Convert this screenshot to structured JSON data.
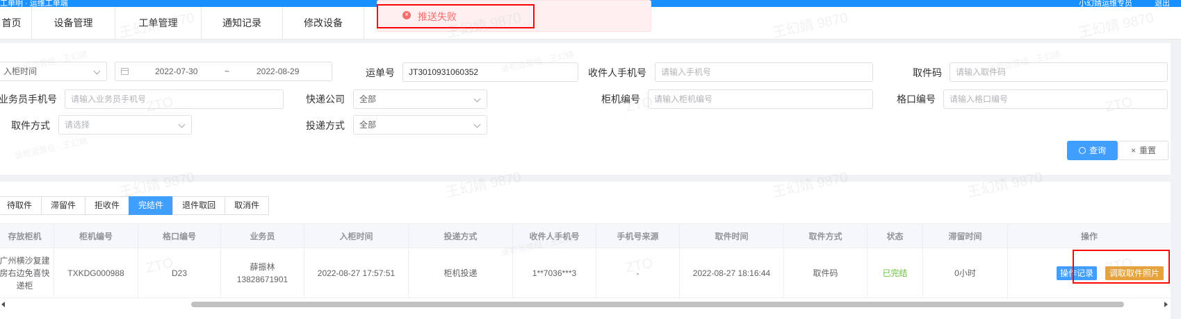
{
  "colors": {
    "primary": "#409eff",
    "success": "#67c23a",
    "warning": "#e6a23c",
    "danger": "#f56c6c",
    "topbar": "#1890ff"
  },
  "topbar": {
    "left_text": "工单明 · 运维工单端",
    "right_text": "小幻婧运维专员",
    "logout": "退出"
  },
  "nav": {
    "items": [
      {
        "label": "首页"
      },
      {
        "label": "设备管理"
      },
      {
        "label": "工单管理"
      },
      {
        "label": "通知记录"
      },
      {
        "label": "修改设备"
      }
    ]
  },
  "toast": {
    "icon": "error-circle-icon",
    "message": "推送失败"
  },
  "filters": {
    "time_type": "入柜时间",
    "date_start": "2022-07-30",
    "date_sep": "~",
    "date_end": "2022-08-29",
    "waybill_label": "运单号",
    "waybill_value": "JT3010931060352",
    "receiver_phone_label": "收件人手机号",
    "receiver_phone_placeholder": "请输入手机号",
    "pickup_code_label": "取件码",
    "pickup_code_placeholder": "请输入取件码",
    "courier_phone_label": "业务员手机号",
    "courier_phone_placeholder": "请输入业务员手机号",
    "express_company_label": "快递公司",
    "express_company_value": "全部",
    "cabinet_no_label": "柜机编号",
    "cabinet_no_placeholder": "请输入柜机编号",
    "slot_no_label": "格口编号",
    "slot_no_placeholder": "请输入格口编号",
    "pickup_method_label": "取件方式",
    "pickup_method_placeholder": "请选择",
    "delivery_method_label": "投递方式",
    "delivery_method_value": "全部",
    "query_button": "查询",
    "reset_button": "重置"
  },
  "tabs": [
    {
      "label": "待取件",
      "active": false
    },
    {
      "label": "滞留件",
      "active": false
    },
    {
      "label": "拒收件",
      "active": false
    },
    {
      "label": "完结件",
      "active": true
    },
    {
      "label": "退件取回",
      "active": false
    },
    {
      "label": "取消件",
      "active": false
    }
  ],
  "table": {
    "headers": [
      "存放柜机",
      "柜机编号",
      "格口编号",
      "业务员",
      "入柜时间",
      "投递方式",
      "收件人手机号",
      "手机号来源",
      "取件时间",
      "取件方式",
      "状态",
      "滞留时间",
      "操作"
    ],
    "rows": [
      {
        "cabinet": "广州横沙复建房右边免喜快递柜",
        "cabinet_no": "TXKDG000988",
        "slot_no": "D23",
        "courier_name": "薛振林",
        "courier_phone": "13828671901",
        "in_time": "2022-08-27 17:57:51",
        "delivery_method": "柜机投递",
        "receiver_phone": "1**7036***3",
        "phone_source": "-",
        "pickup_time": "2022-08-27 18:16:44",
        "pickup_method": "取件码",
        "status": "已完结",
        "stay_time": "0小时",
        "op_log": "操作记录",
        "op_photo": "调取取件照片"
      }
    ]
  },
  "watermark": {
    "name": "王幻婧 9870",
    "company": "ZTO",
    "dept": "速柜运营组 - 王幻婧"
  }
}
